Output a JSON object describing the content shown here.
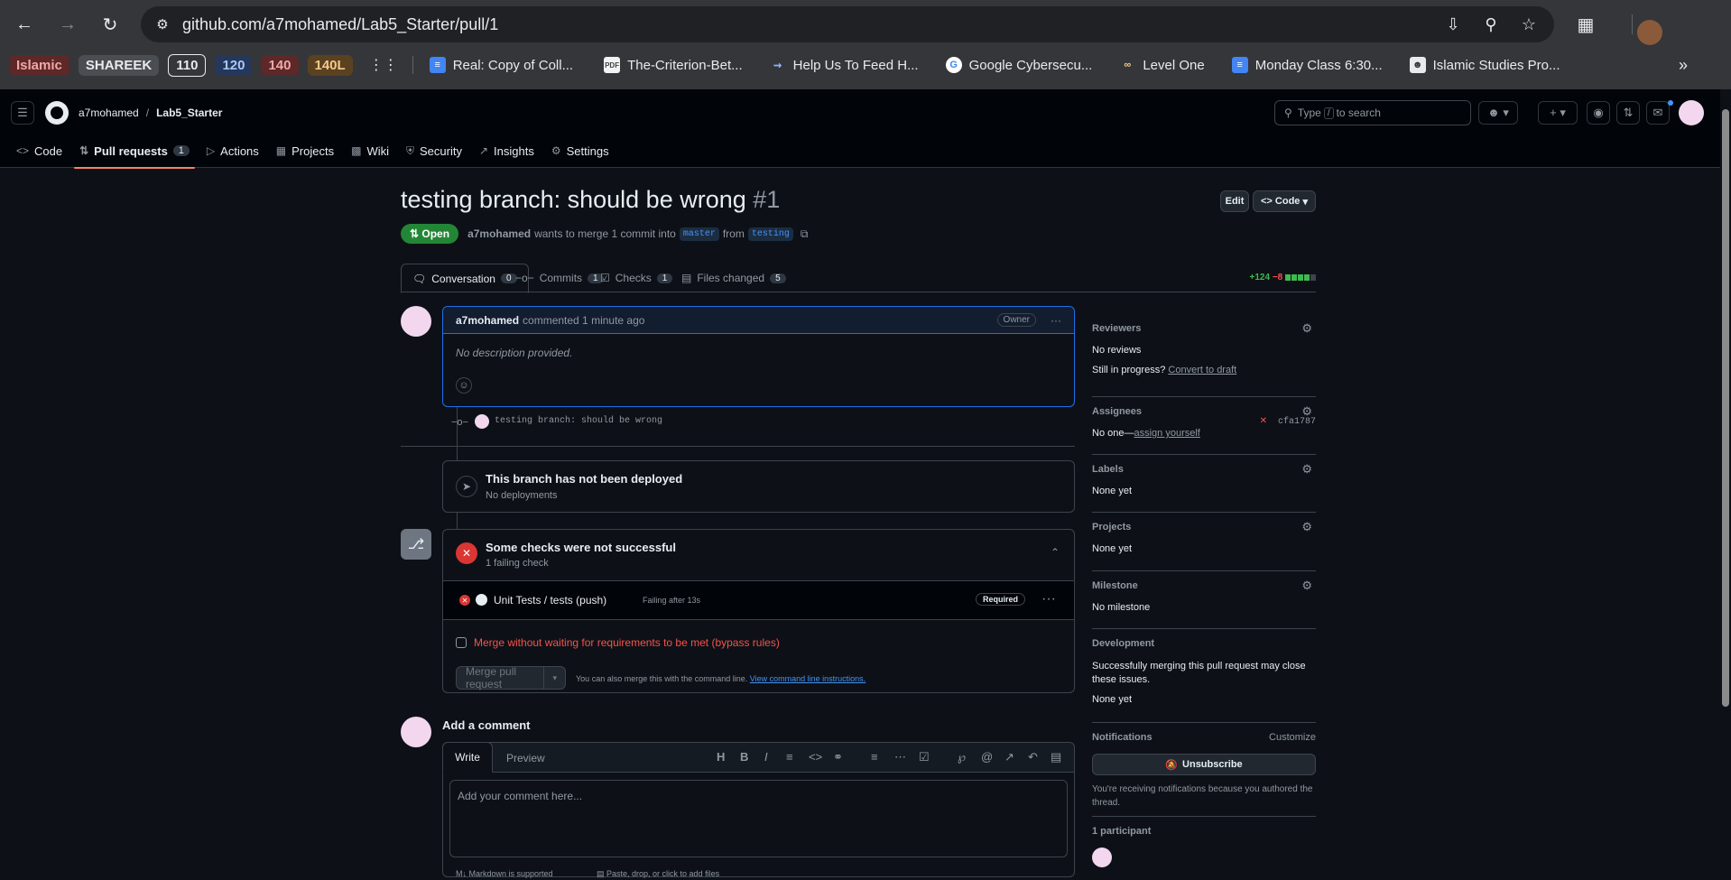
{
  "browser": {
    "url": "github.com/a7mohamed/Lab5_Starter/pull/1",
    "bookmark_tags": [
      {
        "label": "Islamic",
        "bg": "#5c2828",
        "fg": "#f4a6a6"
      },
      {
        "label": "SHAREEK",
        "bg": "#4a4d52",
        "fg": "#e8eaed"
      },
      {
        "label": "110",
        "bg": "#35363a",
        "fg": "#e8eaed"
      },
      {
        "label": "120",
        "bg": "#25375a",
        "fg": "#a8c7fa"
      },
      {
        "label": "140",
        "bg": "#5c2828",
        "fg": "#f4a6a6"
      },
      {
        "label": "140L",
        "bg": "#5a4220",
        "fg": "#f6c88a"
      }
    ],
    "bookmarks": [
      {
        "label": "Real: Copy of Coll...",
        "icon": "docs-icon"
      },
      {
        "label": "The-Criterion-Bet...",
        "icon": "pdf-icon"
      },
      {
        "label": "Help Us To Feed H...",
        "icon": "heart-icon"
      },
      {
        "label": "Google Cybersecu...",
        "icon": "google-icon"
      },
      {
        "label": "Level One",
        "icon": "glasses-icon"
      },
      {
        "label": "Monday Class 6:30...",
        "icon": "docs-icon"
      },
      {
        "label": "Islamic Studies Pro...",
        "icon": "profile-icon"
      }
    ]
  },
  "header": {
    "owner": "a7mohamed",
    "separator": "/",
    "repo": "Lab5_Starter",
    "search_pre": "Type",
    "search_key": "/",
    "search_post": "to search"
  },
  "repo_nav": [
    {
      "label": "Code",
      "icon": "code-icon"
    },
    {
      "label": "Pull requests",
      "icon": "pull-request-icon",
      "count": "1"
    },
    {
      "label": "Actions",
      "icon": "play-icon"
    },
    {
      "label": "Projects",
      "icon": "table-icon"
    },
    {
      "label": "Wiki",
      "icon": "book-icon"
    },
    {
      "label": "Security",
      "icon": "shield-icon"
    },
    {
      "label": "Insights",
      "icon": "graph-icon"
    },
    {
      "label": "Settings",
      "icon": "gear-icon"
    }
  ],
  "pr": {
    "title": "testing branch: should be wrong",
    "number": "#1",
    "edit_label": "Edit",
    "code_label": "Code",
    "state": "Open",
    "author": "a7mohamed",
    "merge_text": "wants to merge 1 commit into",
    "base": "master",
    "from_text": "from",
    "head": "testing",
    "additions": "+124",
    "deletions": "−8"
  },
  "tabs": [
    {
      "label": "Conversation",
      "count": "0"
    },
    {
      "label": "Commits",
      "count": "1"
    },
    {
      "label": "Checks",
      "count": "1"
    },
    {
      "label": "Files changed",
      "count": "5"
    }
  ],
  "comment": {
    "author": "a7mohamed",
    "meta": "commented 1 minute ago",
    "badge": "Owner",
    "body": "No description provided."
  },
  "commit": {
    "message": "testing branch: should be wrong",
    "sha": "cfa1787"
  },
  "deploy": {
    "title": "This branch has not been deployed",
    "subtitle": "No deployments"
  },
  "checks": {
    "title": "Some checks were not successful",
    "subtitle": "1 failing check",
    "item_name": "Unit Tests / tests (push)",
    "item_status": "Failing after 13s",
    "required": "Required",
    "bypass": "Merge without waiting for requirements to be met (bypass rules)",
    "merge_button": "Merge pull request",
    "cli_text": "You can also merge this with the command line.",
    "cli_link": "View command line instructions."
  },
  "add_comment": {
    "heading": "Add a comment",
    "write": "Write",
    "preview": "Preview",
    "placeholder": "Add your comment here...",
    "markdown_note": "Markdown is supported",
    "attach_note": "Paste, drop, or click to add files"
  },
  "sidebar": {
    "reviewers_label": "Reviewers",
    "reviewers_value": "No reviews",
    "in_progress": "Still in progress?",
    "convert": "Convert to draft",
    "assignees_label": "Assignees",
    "assignees_value": "No one—",
    "assign_yourself": "assign yourself",
    "labels_label": "Labels",
    "labels_value": "None yet",
    "projects_label": "Projects",
    "projects_value": "None yet",
    "milestone_label": "Milestone",
    "milestone_value": "No milestone",
    "development_label": "Development",
    "development_text": "Successfully merging this pull request may close these issues.",
    "development_value": "None yet",
    "notifications_label": "Notifications",
    "customize": "Customize",
    "unsubscribe": "Unsubscribe",
    "notif_text": "You're receiving notifications because you authored the thread.",
    "participants": "1 participant"
  },
  "colors": {
    "bg": "#0d1117",
    "border": "#3d444d",
    "accent_link": "#4493f8",
    "open_green": "#238636",
    "fail_red": "#da3633",
    "tab_underline": "#f78166"
  }
}
